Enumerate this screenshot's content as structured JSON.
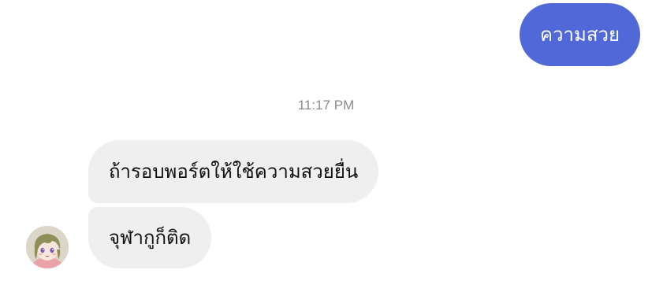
{
  "conversation": {
    "outgoing": [
      {
        "text": "ความสวย"
      }
    ],
    "timestamp": "11:17 PM",
    "incoming": [
      {
        "text": "ถ้ารอบพอร์ตให้ใช้ความสวยยื่น"
      },
      {
        "text": "จุฬากูก็ติด"
      }
    ],
    "avatar": {
      "icon": "anime-character-avatar"
    }
  },
  "colors": {
    "outgoing_bubble": "#5168d8",
    "incoming_bubble": "#efefef",
    "timestamp_text": "#8a8a8a"
  }
}
